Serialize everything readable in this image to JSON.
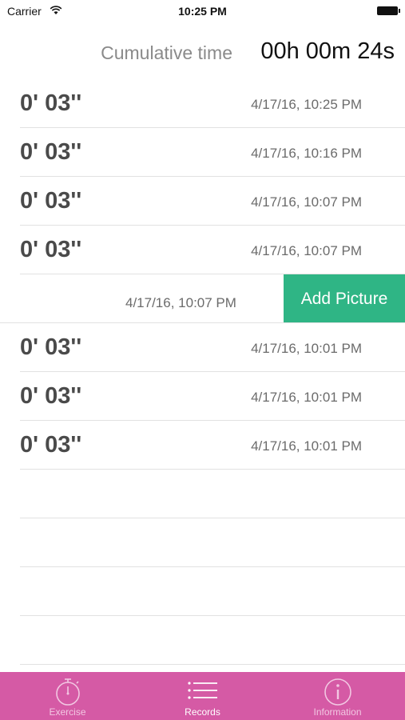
{
  "status_bar": {
    "carrier": "Carrier",
    "time": "10:25 PM"
  },
  "cumulative": {
    "label": "Cumulative time",
    "value": "00h 00m 24s"
  },
  "records": [
    {
      "duration": "0' 03''",
      "date": "4/17/16, 10:25 PM"
    },
    {
      "duration": "0' 03''",
      "date": "4/17/16, 10:16 PM"
    },
    {
      "duration": "0' 03''",
      "date": "4/17/16, 10:07 PM"
    },
    {
      "duration": "0' 03''",
      "date": "4/17/16, 10:07 PM"
    },
    {
      "duration": "",
      "date": "4/17/16, 10:07 PM",
      "action": "Add Picture"
    },
    {
      "duration": "0' 03''",
      "date": "4/17/16, 10:01 PM"
    },
    {
      "duration": "0' 03''",
      "date": "4/17/16, 10:01 PM"
    },
    {
      "duration": "0' 03''",
      "date": "4/17/16, 10:01 PM"
    }
  ],
  "tabbar": {
    "tabs": [
      {
        "label": "Exercise",
        "icon": "stopwatch-icon",
        "active": false
      },
      {
        "label": "Records",
        "icon": "list-icon",
        "active": true
      },
      {
        "label": "Information",
        "icon": "info-icon",
        "active": false
      }
    ]
  },
  "colors": {
    "tab_background": "#d55aa5",
    "action_button": "#2fb585"
  }
}
